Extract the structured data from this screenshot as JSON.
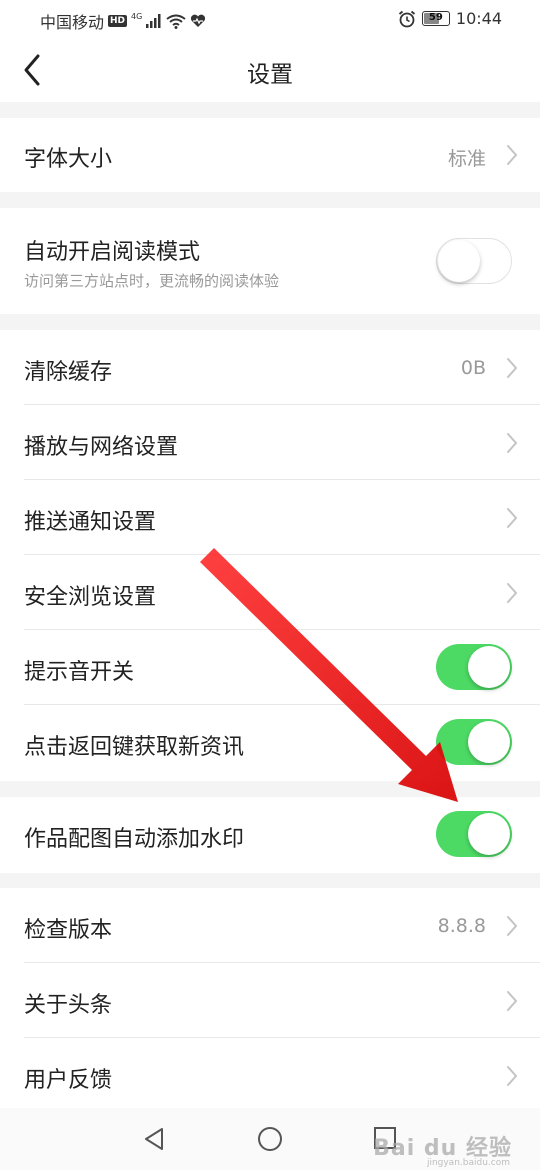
{
  "status_bar": {
    "carrier": "中国移动",
    "hd": "HD",
    "network": "4G",
    "battery": "59",
    "time": "10:44"
  },
  "header": {
    "title": "设置",
    "back_icon": "chevron-left-icon"
  },
  "rows": {
    "font_size": {
      "label": "字体大小",
      "value": "标准"
    },
    "reading_mode": {
      "label": "自动开启阅读模式",
      "sub": "访问第三方站点时，更流畅的阅读体验",
      "enabled": false
    },
    "clear_cache": {
      "label": "清除缓存",
      "value": "0B"
    },
    "playback_network": {
      "label": "播放与网络设置"
    },
    "push_notify": {
      "label": "推送通知设置"
    },
    "safe_browse": {
      "label": "安全浏览设置"
    },
    "sound_toggle": {
      "label": "提示音开关",
      "enabled": true
    },
    "back_refresh": {
      "label": "点击返回键获取新资讯",
      "enabled": true
    },
    "watermark": {
      "label": "作品配图自动添加水印",
      "enabled": true
    },
    "check_version": {
      "label": "检查版本",
      "value": "8.8.8"
    },
    "about": {
      "label": "关于头条"
    },
    "feedback": {
      "label": "用户反馈"
    }
  },
  "colors": {
    "toggle_on": "#4cd964",
    "arrow": "#e01010",
    "background": "#f4f4f4"
  },
  "watermark_text": {
    "brand": "Bai du 经验",
    "url": "jingyan.baidu.com"
  }
}
